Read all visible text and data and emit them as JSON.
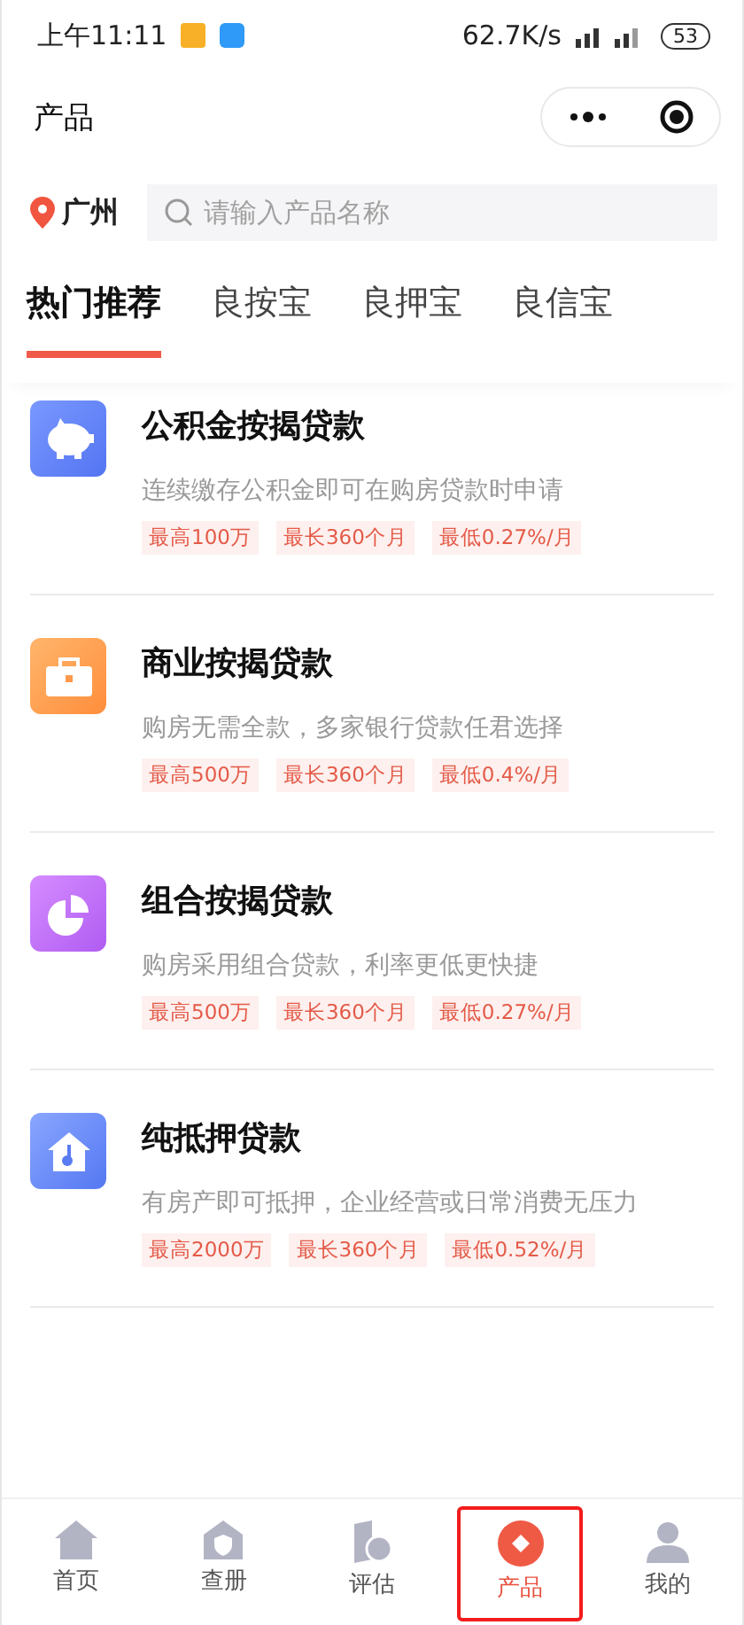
{
  "status_bar": {
    "time": "上午11:11",
    "speed": "62.7K/s",
    "battery": "53"
  },
  "header": {
    "title": "产品"
  },
  "location": {
    "city": "广州"
  },
  "search": {
    "placeholder": "请输入产品名称"
  },
  "tabs": [
    {
      "label": "热门推荐",
      "selected": true
    },
    {
      "label": "良按宝",
      "selected": false
    },
    {
      "label": "良押宝",
      "selected": false
    },
    {
      "label": "良信宝",
      "selected": false
    }
  ],
  "products": [
    {
      "kind": "piggy",
      "name": "公积金按揭贷款",
      "description": "连续缴存公积金即可在购房贷款时申请",
      "tags": [
        "最高100万",
        "最长360个月",
        "最低0.27%/月"
      ]
    },
    {
      "kind": "briefcase",
      "name": "商业按揭贷款",
      "description": "购房无需全款，多家银行贷款任君选择",
      "tags": [
        "最高500万",
        "最长360个月",
        "最低0.4%/月"
      ]
    },
    {
      "kind": "pie",
      "name": "组合按揭贷款",
      "description": "购房采用组合贷款，利率更低更快捷",
      "tags": [
        "最高500万",
        "最长360个月",
        "最低0.27%/月"
      ]
    },
    {
      "kind": "house",
      "name": "纯抵押贷款",
      "description": "有房产即可抵押，企业经营或日常消费无压力",
      "tags": [
        "最高2000万",
        "最长360个月",
        "最低0.52%/月"
      ]
    }
  ],
  "bottom_nav": [
    {
      "kind": "home",
      "label": "首页",
      "selected": false
    },
    {
      "kind": "shield",
      "label": "查册",
      "selected": false
    },
    {
      "kind": "assess",
      "label": "评估",
      "selected": false
    },
    {
      "kind": "product",
      "label": "产品",
      "selected": true
    },
    {
      "kind": "user",
      "label": "我的",
      "selected": false
    }
  ]
}
